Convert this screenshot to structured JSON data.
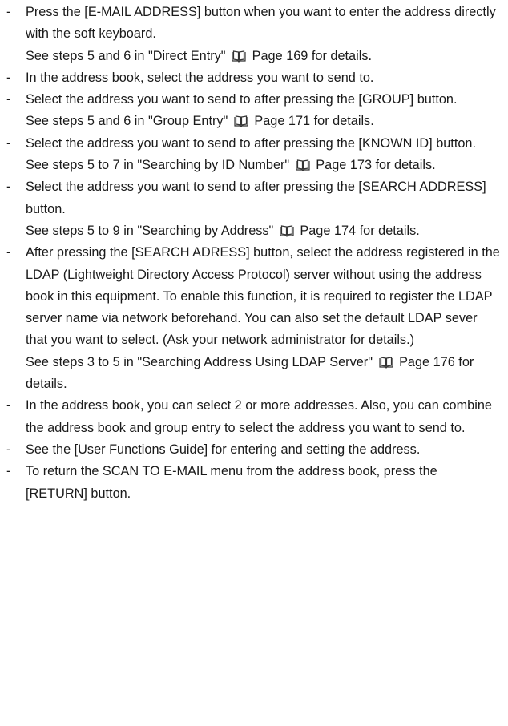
{
  "notes": [
    {
      "lines": [
        "Press the [E-MAIL ADDRESS] button when you want to enter the address directly with the soft keyboard."
      ],
      "ref": {
        "before": "See steps 5 and 6 in \"Direct Entry\"",
        "after": "Page 169 for details."
      }
    },
    {
      "lines": [
        "In the address book, select the address you want to send to."
      ]
    },
    {
      "lines": [
        "Select the address you want to send to after pressing the [GROUP] button."
      ],
      "ref": {
        "before": "See steps 5 and 6 in \"Group Entry\"",
        "after": "Page 171 for details."
      }
    },
    {
      "lines": [
        "Select the address you want to send to after pressing the [KNOWN ID] button."
      ],
      "ref": {
        "before": "See steps 5 to 7 in \"Searching by ID Number\"",
        "after": "Page 173 for details."
      }
    },
    {
      "lines": [
        "Select the address you want to send to after pressing the [SEARCH ADDRESS] button."
      ],
      "ref": {
        "before": "See steps 5 to 9 in \"Searching by Address\"",
        "after": "Page 174 for details."
      }
    },
    {
      "lines": [
        "After pressing the [SEARCH ADRESS] button, select the address registered in the LDAP (Lightweight Directory Access Protocol) server without using the address book in this equipment. To enable this function, it is required to register the LDAP server name via network beforehand. You can also set the default LDAP sever that you want to select. (Ask your network administrator for details.)"
      ],
      "ref": {
        "before": "See steps 3 to 5 in \"Searching Address Using LDAP Server\"",
        "after": "Page 176 for details."
      }
    },
    {
      "lines": [
        "In the address book, you can select 2 or more addresses. Also, you can combine the address book and group entry to select the address you want to send to."
      ]
    },
    {
      "lines": [
        "See the [User Functions Guide] for entering and setting the address."
      ]
    },
    {
      "lines": [
        "To return the SCAN TO E-MAIL menu from the address book, press the [RETURN] button."
      ]
    }
  ],
  "bullet_char": "-",
  "icons": {
    "page_ref": "book-icon"
  }
}
